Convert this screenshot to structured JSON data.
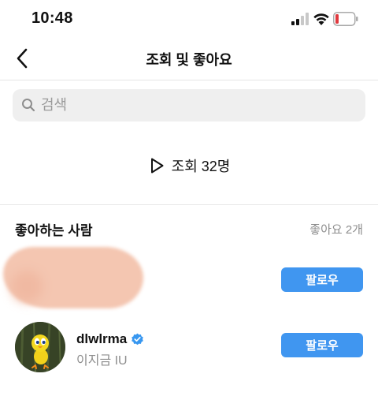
{
  "status_bar": {
    "time": "10:48",
    "battery_color": "#e0393e"
  },
  "header": {
    "title": "조회 및 좋아요"
  },
  "search": {
    "placeholder": "검색",
    "value": ""
  },
  "views": {
    "label": "조회 32명"
  },
  "likes": {
    "section_title": "좋아하는 사람",
    "count_label": "좋아요 2개",
    "users": [
      {
        "username": "",
        "full_name": "",
        "redacted": true,
        "follow_label": "팔로우"
      },
      {
        "username": "dlwlrma",
        "full_name": "이지금 IU",
        "verified": true,
        "follow_label": "팔로우"
      }
    ]
  },
  "colors": {
    "follow_button": "#4096f0",
    "verified_badge": "#3897f0",
    "redaction": "#f4c6b1"
  }
}
